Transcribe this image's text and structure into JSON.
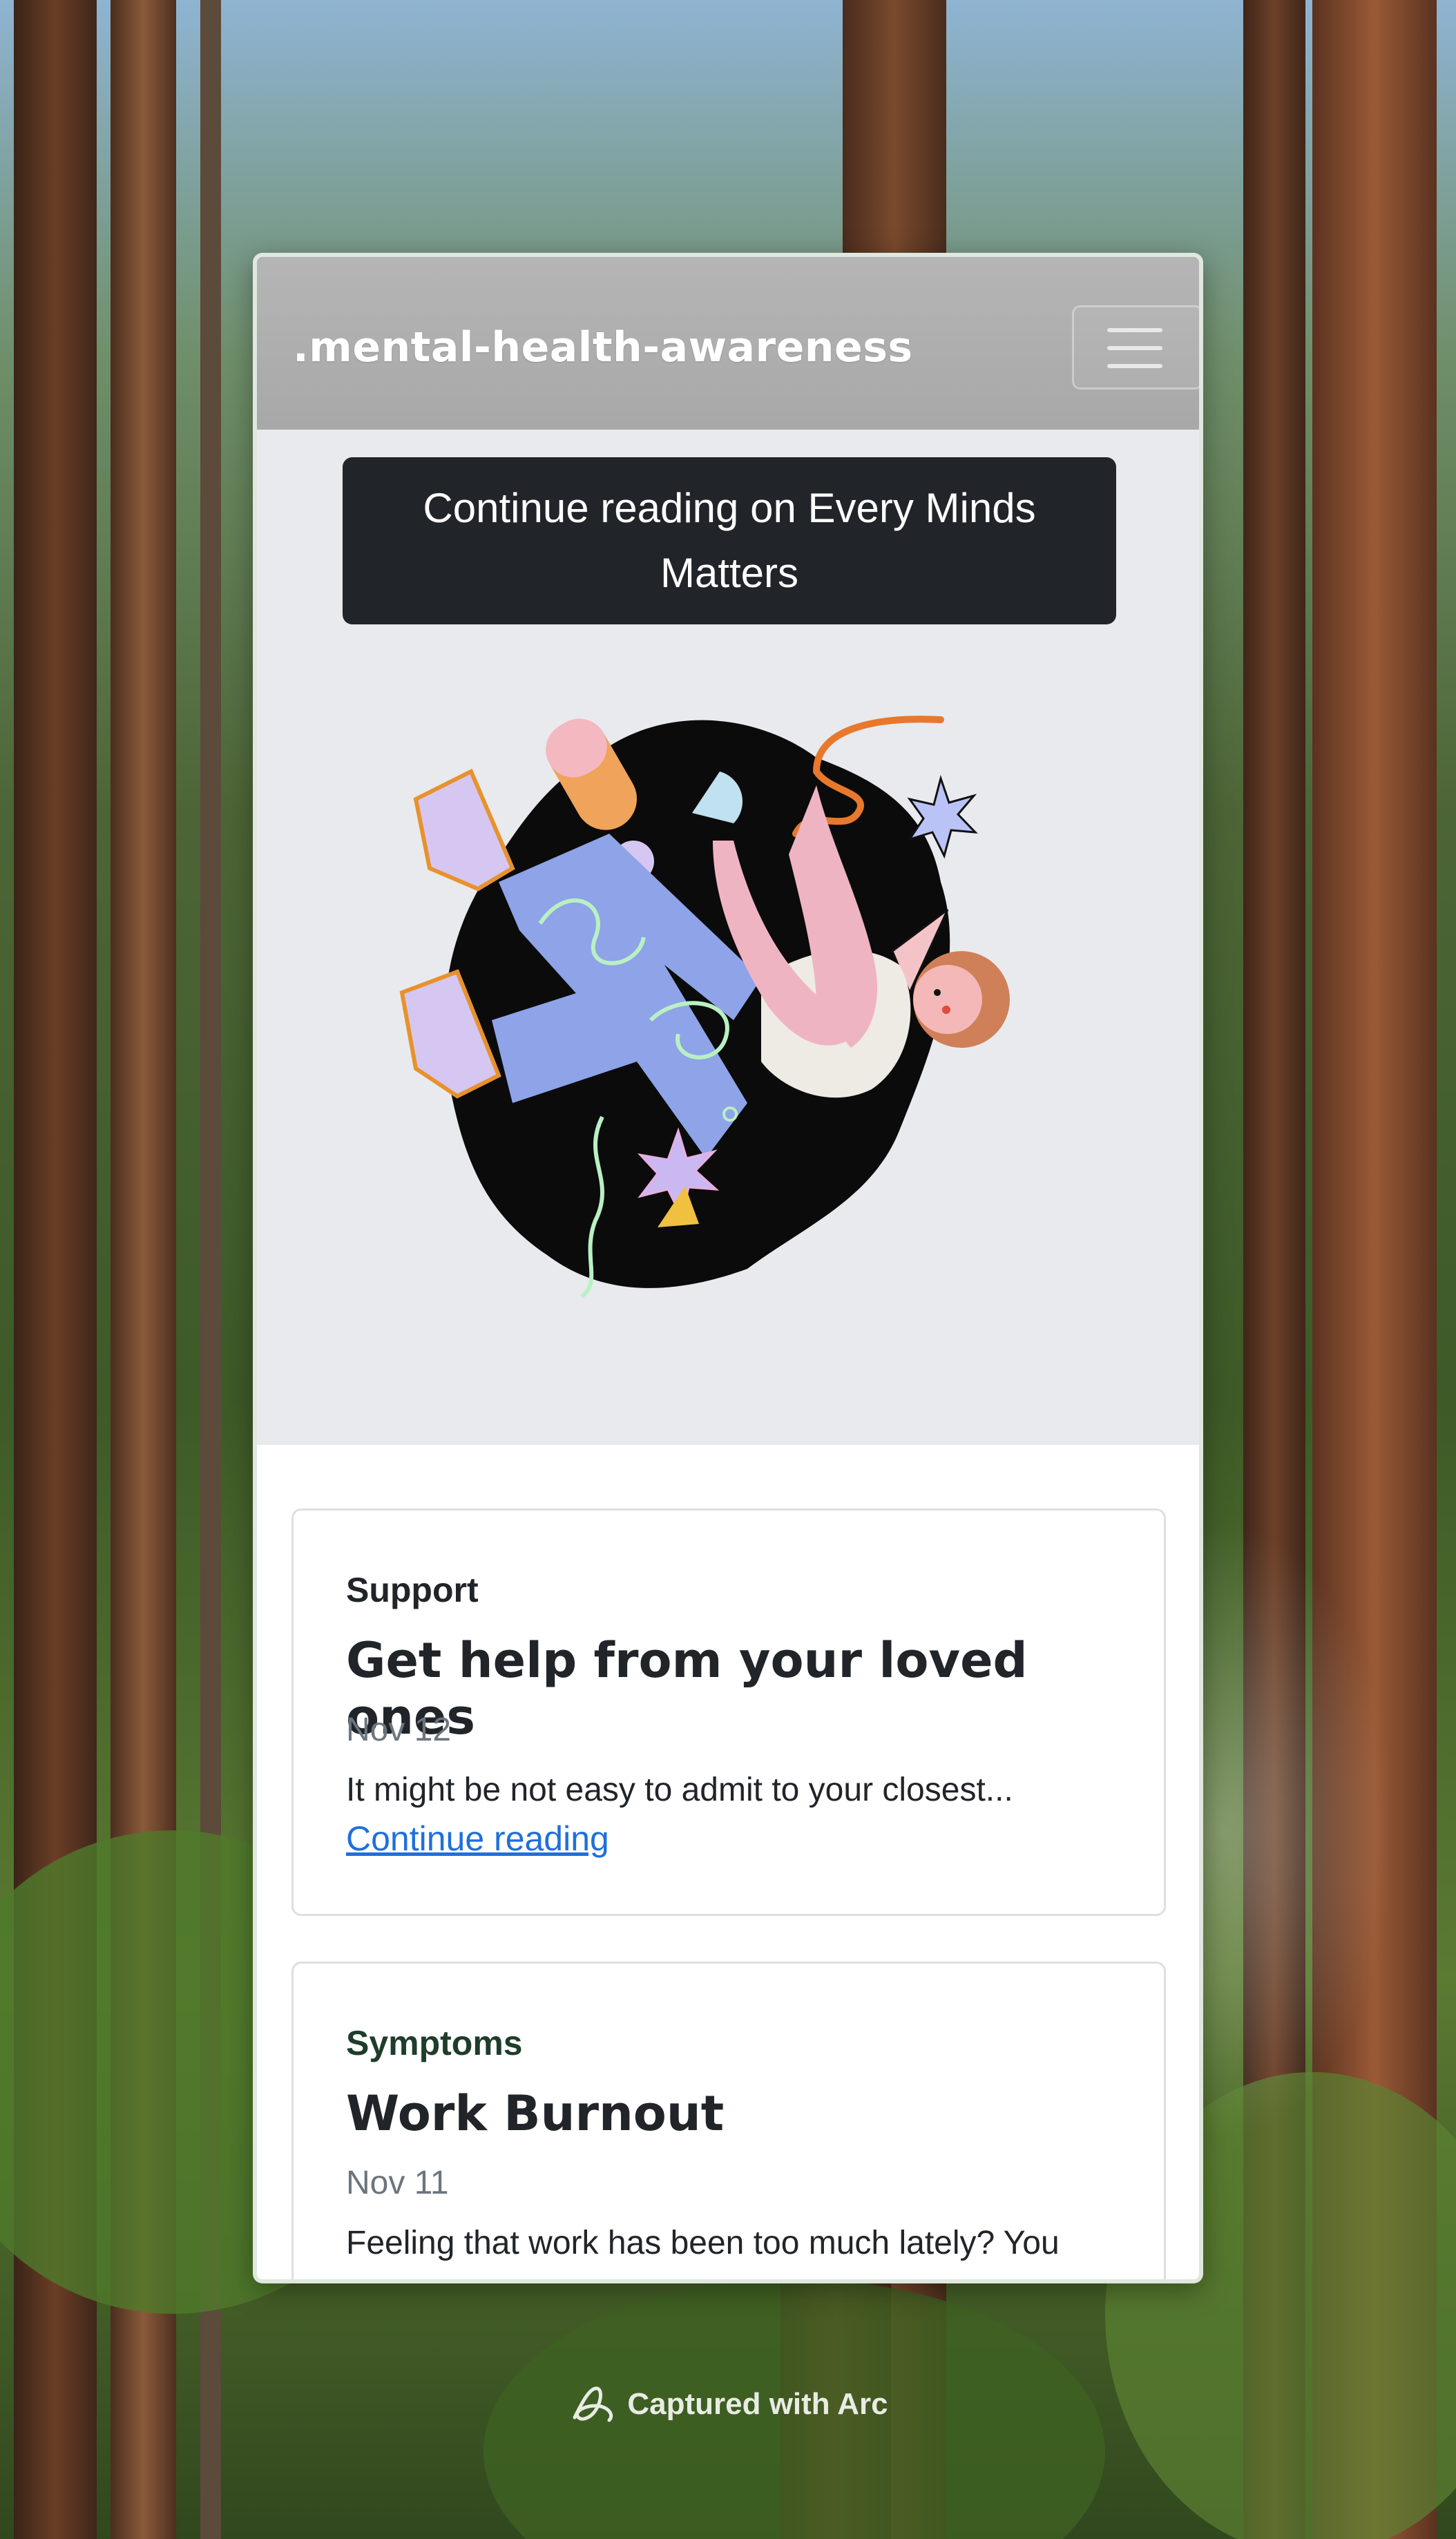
{
  "navbar": {
    "brand": ".mental-health-awareness",
    "toggler_icon": "hamburger-menu-icon"
  },
  "hero": {
    "cta_label": "Continue reading on Every Minds Matters",
    "illustration": "person-floating-illustration"
  },
  "articles": [
    {
      "category": "Support",
      "title": "Get help from your loved ones",
      "date": "Nov 12",
      "excerpt": "It might be not easy to admit to your closest...",
      "link_label": "Continue reading"
    },
    {
      "category": "Symptoms",
      "title": "Work Burnout",
      "date": "Nov 11",
      "excerpt": "Feeling that work has been too much lately? You might be burned out, early..."
    }
  ],
  "footer": {
    "label": "Captured with Arc",
    "icon": "arc-logo-icon"
  },
  "colors": {
    "navbar": "#aaaaaa",
    "cta_background": "#212529",
    "link": "#1f6fdc",
    "hero_background": "#e9eaee"
  }
}
